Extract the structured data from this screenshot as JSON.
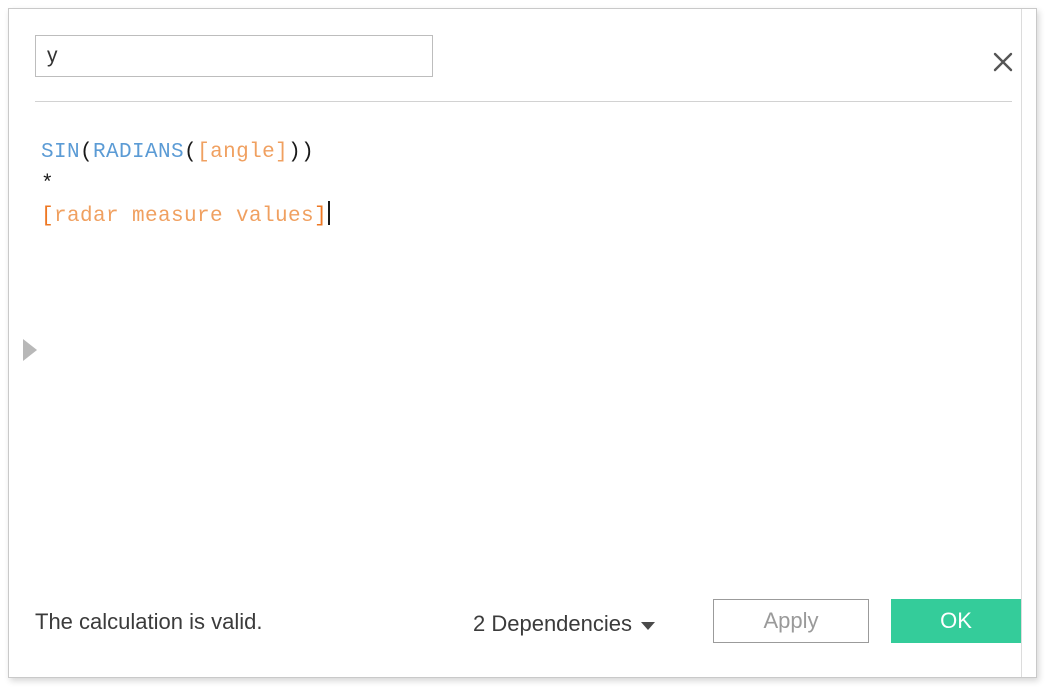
{
  "dialog": {
    "name_field": {
      "value": "y",
      "placeholder": "Name"
    },
    "close_icon": "close-icon"
  },
  "formula": {
    "raw": "SIN(RADIANS([angle]))\n*\n[radar measure values]",
    "tokens": {
      "sin": "SIN",
      "open_paren_1": "(",
      "radians": "RADIANS",
      "open_paren_2": "(",
      "field_angle": "[angle]",
      "close_paren_1": ")",
      "close_paren_2": ")",
      "operator": "*",
      "field_radar_open": "[",
      "field_radar_text": "radar measure values",
      "field_radar_close": "]"
    }
  },
  "expander": {
    "icon": "triangle-right-icon"
  },
  "footer": {
    "validation_status": "The calculation is valid.",
    "dependencies_label": "2 Dependencies",
    "dependencies_caret_icon": "chevron-down-icon",
    "apply_label": "Apply",
    "ok_label": "OK"
  },
  "colors": {
    "ok_button_background": "#34cc9a",
    "function_token": "#5b9bd5",
    "field_token": "#f0a060",
    "bracket_token": "#ee7722",
    "border": "#c9c9c9",
    "divider": "#d2d2d2"
  }
}
